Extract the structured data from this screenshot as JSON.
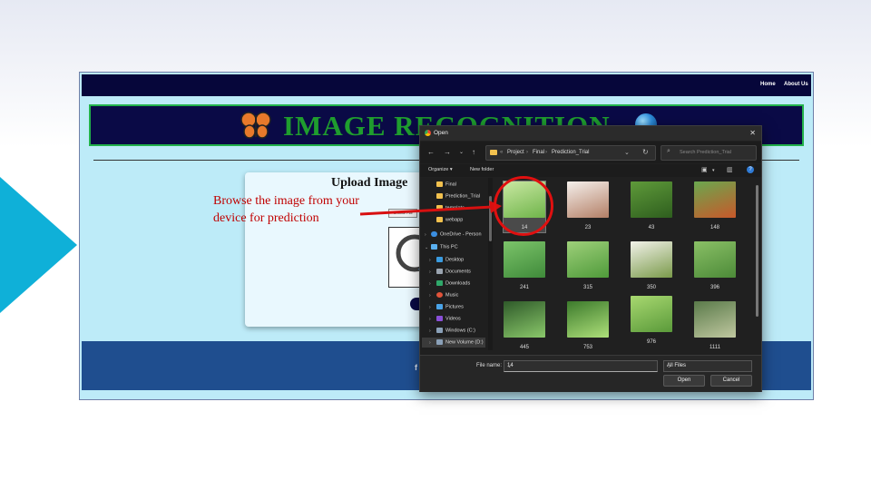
{
  "site": {
    "nav": [
      "Home",
      "About Us"
    ],
    "banner_title": "IMAGE RECOGNITION",
    "upload_title": "Upload Image",
    "choose_file": "Choose File"
  },
  "annotation": {
    "line1": "Browse the image from your",
    "line2": "device for prediction",
    "color": "#c00000"
  },
  "dialog": {
    "title": "Open",
    "breadcrumb": [
      "Project",
      "Final",
      "Prediction_Trial"
    ],
    "search_placeholder": "Search Prediction_Trial",
    "toolbar": {
      "organize": "Organize",
      "new_folder": "New folder"
    },
    "sidebar": [
      {
        "label": "Final",
        "icon": "folder-icon"
      },
      {
        "label": "Prediction_Trial",
        "icon": "folder-icon"
      },
      {
        "label": "template",
        "icon": "folder-icon"
      },
      {
        "label": "webapp",
        "icon": "folder-icon"
      },
      {
        "label": "OneDrive - Person",
        "icon": "cloud-icon"
      },
      {
        "label": "This PC",
        "icon": "pc-icon"
      },
      {
        "label": "Desktop",
        "icon": "desktop-icon"
      },
      {
        "label": "Documents",
        "icon": "documents-icon"
      },
      {
        "label": "Downloads",
        "icon": "download-icon"
      },
      {
        "label": "Music",
        "icon": "music-icon"
      },
      {
        "label": "Pictures",
        "icon": "pictures-icon"
      },
      {
        "label": "Videos",
        "icon": "videos-icon"
      },
      {
        "label": "Windows (C:)",
        "icon": "drive-icon"
      },
      {
        "label": "New Volume (D:)",
        "icon": "drive-icon"
      }
    ],
    "files": [
      "14",
      "23",
      "43",
      "148",
      "241",
      "315",
      "350",
      "396",
      "445",
      "753",
      "976",
      "1111"
    ],
    "selected_file": "14",
    "file_name_label": "File name:",
    "file_name_value": "14",
    "file_type": "All Files",
    "open_button": "Open",
    "cancel_button": "Cancel"
  },
  "colors": {
    "accent_arrow": "#0fb0d8",
    "highlight": "#e01010",
    "banner_bg": "#0a0a46",
    "banner_text": "#1f9d2e"
  }
}
